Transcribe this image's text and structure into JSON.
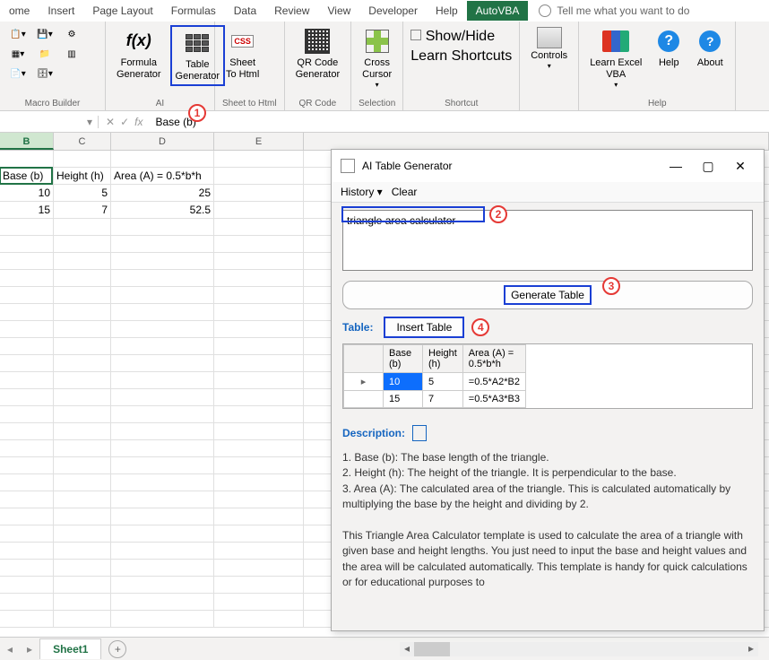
{
  "tabs": [
    "ome",
    "Insert",
    "Page Layout",
    "Formulas",
    "Data",
    "Review",
    "View",
    "Developer",
    "Help",
    "AutoVBA"
  ],
  "active_tab": "AutoVBA",
  "tell_me": "Tell me what you want to do",
  "ribbon": {
    "macro_builder": "Macro Builder",
    "formula_gen": "Formula\nGenerator",
    "table_gen": "Table\nGenerator",
    "ai": "AI",
    "sheet_html": "Sheet\nTo Html",
    "sheet_html_grp": "Sheet to Html",
    "qr": "QR Code\nGenerator",
    "qr_grp": "QR Code",
    "cross": "Cross\nCursor",
    "sel_grp": "Selection",
    "showhide": "Show/Hide",
    "shortcuts": "Learn Shortcuts",
    "shortcut_grp": "Shortcut",
    "controls": "Controls",
    "learn_vba": "Learn Excel\nVBA",
    "help": "Help",
    "about": "About",
    "help_grp": "Help"
  },
  "namebox": "",
  "formula": "Base (b)",
  "cols": {
    "B": "B",
    "C": "C",
    "D": "D",
    "E": "E"
  },
  "sheet": {
    "h1": "Base (b)",
    "h2": "Height (h)",
    "h3": "Area (A) = 0.5*b*h",
    "r1c1": "10",
    "r1c2": "5",
    "r1c3": "25",
    "r2c1": "15",
    "r2c2": "7",
    "r2c3": "52.5"
  },
  "dialog": {
    "title": "AI Table Generator",
    "history": "History",
    "clear": "Clear",
    "prompt": "triangle area calculator",
    "gen": "Generate Table",
    "table_lbl": "Table:",
    "insert": "Insert Table",
    "preview": {
      "h1": "Base\n(b)",
      "h2": "Height\n(h)",
      "h3": "Area (A) =\n0.5*b*h",
      "r1c1": "10",
      "r1c2": "5",
      "r1c3": "=0.5*A2*B2",
      "r2c1": "15",
      "r2c2": "7",
      "r2c3": "=0.5*A3*B3"
    },
    "desc_lbl": "Description:",
    "desc1": "1. Base (b): The base length of the triangle.",
    "desc2": "2. Height (h): The height of the triangle. It is perpendicular to the base.",
    "desc3": "3. Area (A): The calculated area of the triangle. This is calculated automatically by multiplying the base by the height and dividing by 2.",
    "desc4": "This Triangle Area Calculator template is used to calculate the area of a triangle with given base and height lengths. You just need to input the base and height values and the area will be calculated automatically. This template is handy for quick calculations or for educational purposes to"
  },
  "anno": {
    "1": "1",
    "2": "2",
    "3": "3",
    "4": "4"
  },
  "sheet_tab": "Sheet1",
  "chart_data": {
    "type": "table",
    "title": "Triangle Area Calculator",
    "columns": [
      "Base (b)",
      "Height (h)",
      "Area (A) = 0.5*b*h"
    ],
    "rows": [
      {
        "base": 10,
        "height": 5,
        "area": 25
      },
      {
        "base": 15,
        "height": 7,
        "area": 52.5
      }
    ]
  }
}
